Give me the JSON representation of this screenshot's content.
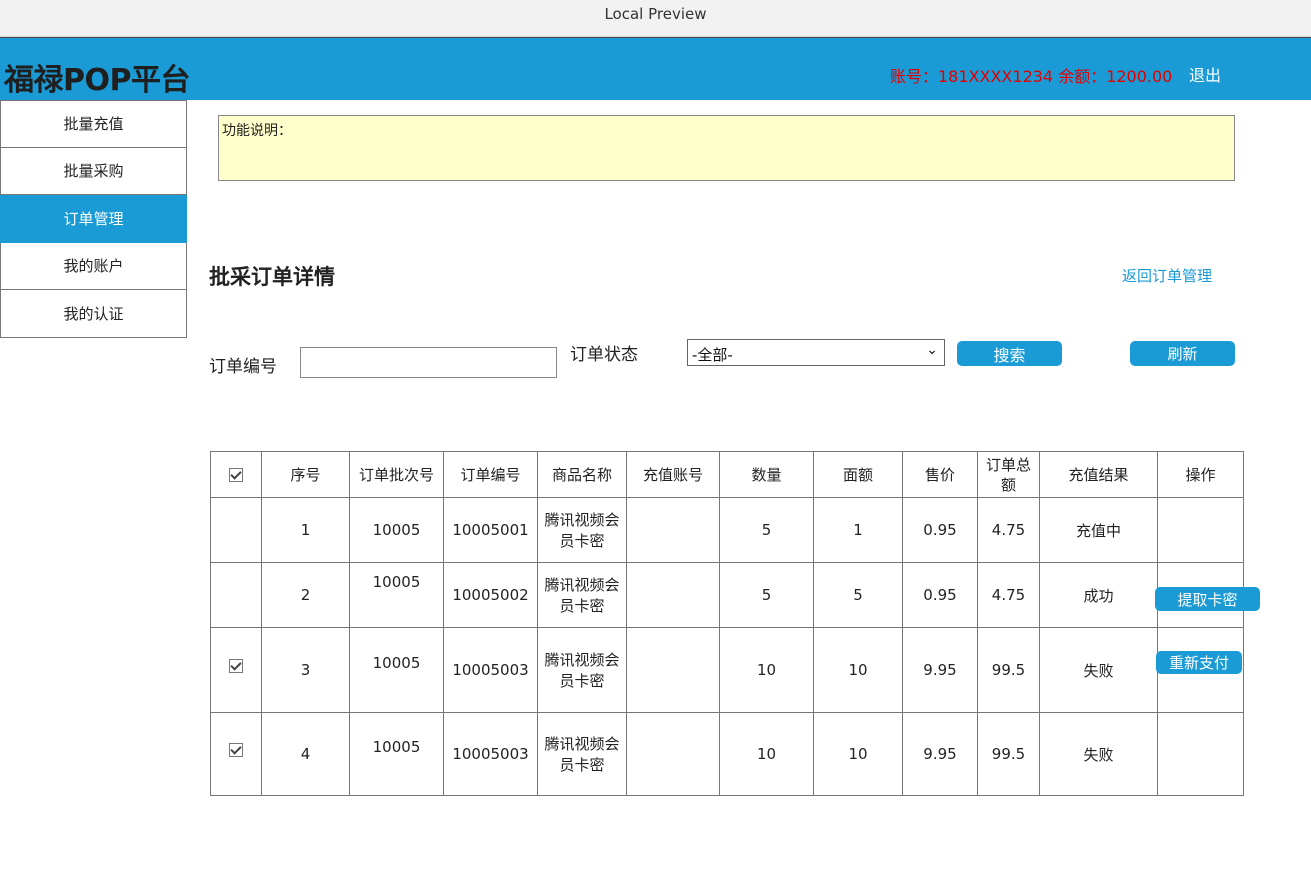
{
  "window": {
    "title": "Local Preview"
  },
  "header": {
    "logo": "福禄POP平台",
    "account_info": "账号：181XXXX1234 余额：1200.00",
    "logout_label": "退出"
  },
  "sidebar": {
    "items": [
      {
        "label": "批量充值",
        "active": false
      },
      {
        "label": "批量采购",
        "active": false
      },
      {
        "label": "订单管理",
        "active": true
      },
      {
        "label": "我的账户",
        "active": false
      },
      {
        "label": "我的认证",
        "active": false
      }
    ]
  },
  "notice": {
    "text": "功能说明："
  },
  "page": {
    "title": "批采订单详情",
    "back_link": "返回订单管理"
  },
  "filters": {
    "order_no_label": "订单编号",
    "order_no_value": "",
    "status_label": "订单状态",
    "status_value": "-全部-",
    "search_label": "搜索",
    "refresh_label": "刷新"
  },
  "table": {
    "headers": [
      "",
      "序号",
      "订单批次号",
      "订单编号",
      "商品名称",
      "充值账号",
      "数量",
      "面额",
      "售价",
      "订单总额",
      "充值结果",
      "操作"
    ],
    "rows": [
      {
        "checked": false,
        "seq": "1",
        "batch": "10005",
        "order": "10005001",
        "product": "腾讯视频会员卡密",
        "account": "",
        "qty": "5",
        "face": "1",
        "price": "0.95",
        "total": "4.75",
        "result": "充值中",
        "action": ""
      },
      {
        "checked": false,
        "seq": "2",
        "batch": "10005",
        "order": "10005002",
        "product": "腾讯视频会员卡密",
        "account": "",
        "qty": "5",
        "face": "5",
        "price": "0.95",
        "total": "4.75",
        "result": "成功",
        "action": "提取卡密"
      },
      {
        "checked": true,
        "seq": "3",
        "batch": "10005",
        "order": "10005003",
        "product": "腾讯视频会员卡密",
        "account": "",
        "qty": "10",
        "face": "10",
        "price": "9.95",
        "total": "99.5",
        "result": "失败",
        "action": "重新支付"
      },
      {
        "checked": true,
        "seq": "4",
        "batch": "10005",
        "order": "10005003",
        "product": "腾讯视频会员卡密",
        "account": "",
        "qty": "10",
        "face": "10",
        "price": "9.95",
        "total": "99.5",
        "result": "失败",
        "action": ""
      }
    ]
  },
  "colors": {
    "brand": "#1b9bd6",
    "balance_text": "#e00000",
    "notice_bg": "#ffffcc"
  },
  "icons": {
    "select_arrow": "chevron-down-icon",
    "checkbox": "checkbox-checked-icon"
  }
}
